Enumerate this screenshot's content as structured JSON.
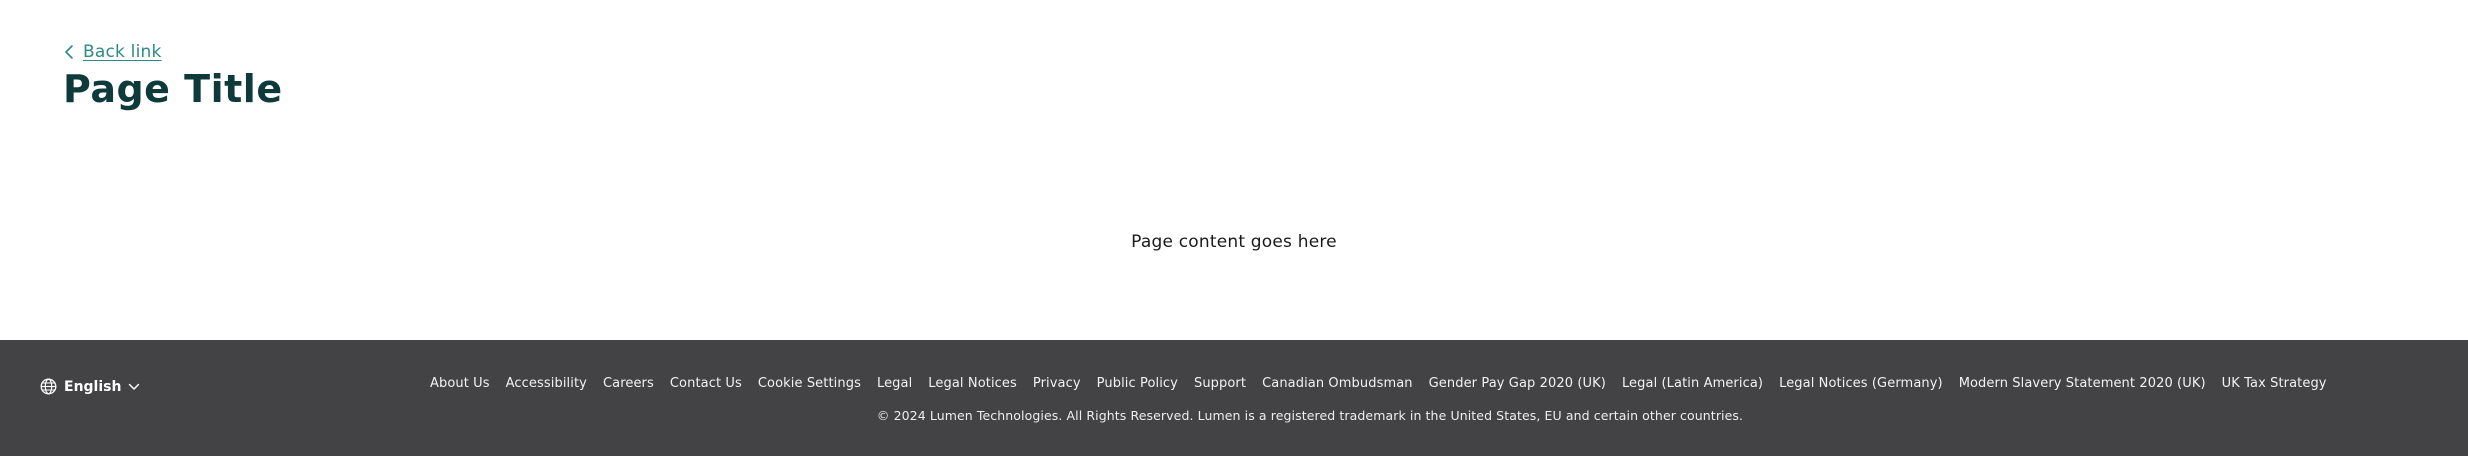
{
  "header": {
    "back_link": "Back link",
    "title": "Page Title"
  },
  "main": {
    "content": "Page content goes here"
  },
  "footer": {
    "language": "English",
    "links": [
      "About Us",
      "Accessibility",
      "Careers",
      "Contact Us",
      "Cookie Settings",
      "Legal",
      "Legal Notices",
      "Privacy",
      "Public Policy",
      "Support",
      "Canadian Ombudsman",
      "Gender Pay Gap 2020 (UK)",
      "Legal (Latin America)",
      "Legal Notices (Germany)",
      "Modern Slavery Statement 2020 (UK)",
      "UK Tax Strategy"
    ],
    "copyright": "© 2024 Lumen Technologies. All Rights Reserved. Lumen is a registered trademark in the United States, EU and certain other countries."
  },
  "colors": {
    "accent": "#2d8a89",
    "title": "#0f3a3b",
    "footer_bg": "#434245"
  },
  "icons": {
    "back": "chevron-left-icon",
    "language": "globe-icon",
    "dropdown": "chevron-down-icon"
  }
}
